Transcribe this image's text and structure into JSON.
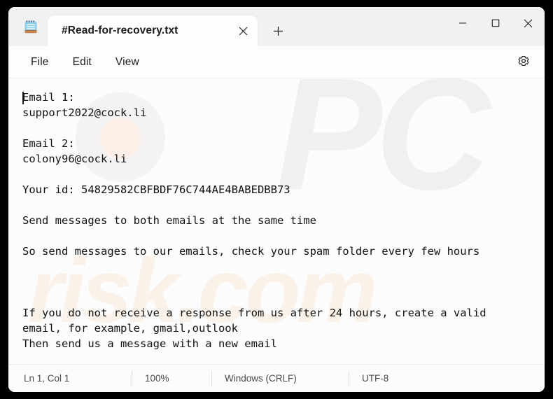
{
  "window": {
    "app_icon": "notepad-icon",
    "tab": {
      "title": "#Read-for-recovery.txt",
      "close_icon": "close-icon"
    },
    "new_tab_icon": "plus-icon",
    "controls": {
      "minimize_icon": "minimize-icon",
      "maximize_icon": "maximize-icon",
      "close_icon": "close-icon"
    }
  },
  "menubar": {
    "items": [
      {
        "label": "File"
      },
      {
        "label": "Edit"
      },
      {
        "label": "View"
      }
    ],
    "settings_icon": "gear-icon"
  },
  "editor": {
    "content": "Email 1:\nsupport2022@cock.li\n\nEmail 2:\ncolony96@cock.li\n\nYour id: 54829582CBFBDF76C744AE4BABEDBB73\n\nSend messages to both emails at the same time\n\nSo send messages to our emails, check your spam folder every few hours\n\n\n\nIf you do not receive a response from us after 24 hours, create a valid\nemail, for example, gmail,outlook\nThen send us a message with a new email",
    "emails": [
      {
        "label": "Email 1:",
        "address": "support2022@cock.li"
      },
      {
        "label": "Email 2:",
        "address": "colony96@cock.li"
      }
    ],
    "victim_id_label": "Your id:",
    "victim_id": "54829582CBFBDF76C744AE4BABEDBB73",
    "instructions": [
      "Send messages to both emails at the same time",
      "So send messages to our emails, check your spam folder every few hours",
      "If you do not receive a response from us after 24 hours, create a valid email, for example, gmail,outlook",
      "Then send us a message with a new email"
    ],
    "watermark": {
      "primary": "PC",
      "secondary": "risk.com",
      "primary_color": "#f0f0f0",
      "secondary_color": "#faf1e9"
    }
  },
  "statusbar": {
    "cursor_position": "Ln 1, Col 1",
    "zoom": "100%",
    "line_ending": "Windows (CRLF)",
    "encoding": "UTF-8"
  }
}
